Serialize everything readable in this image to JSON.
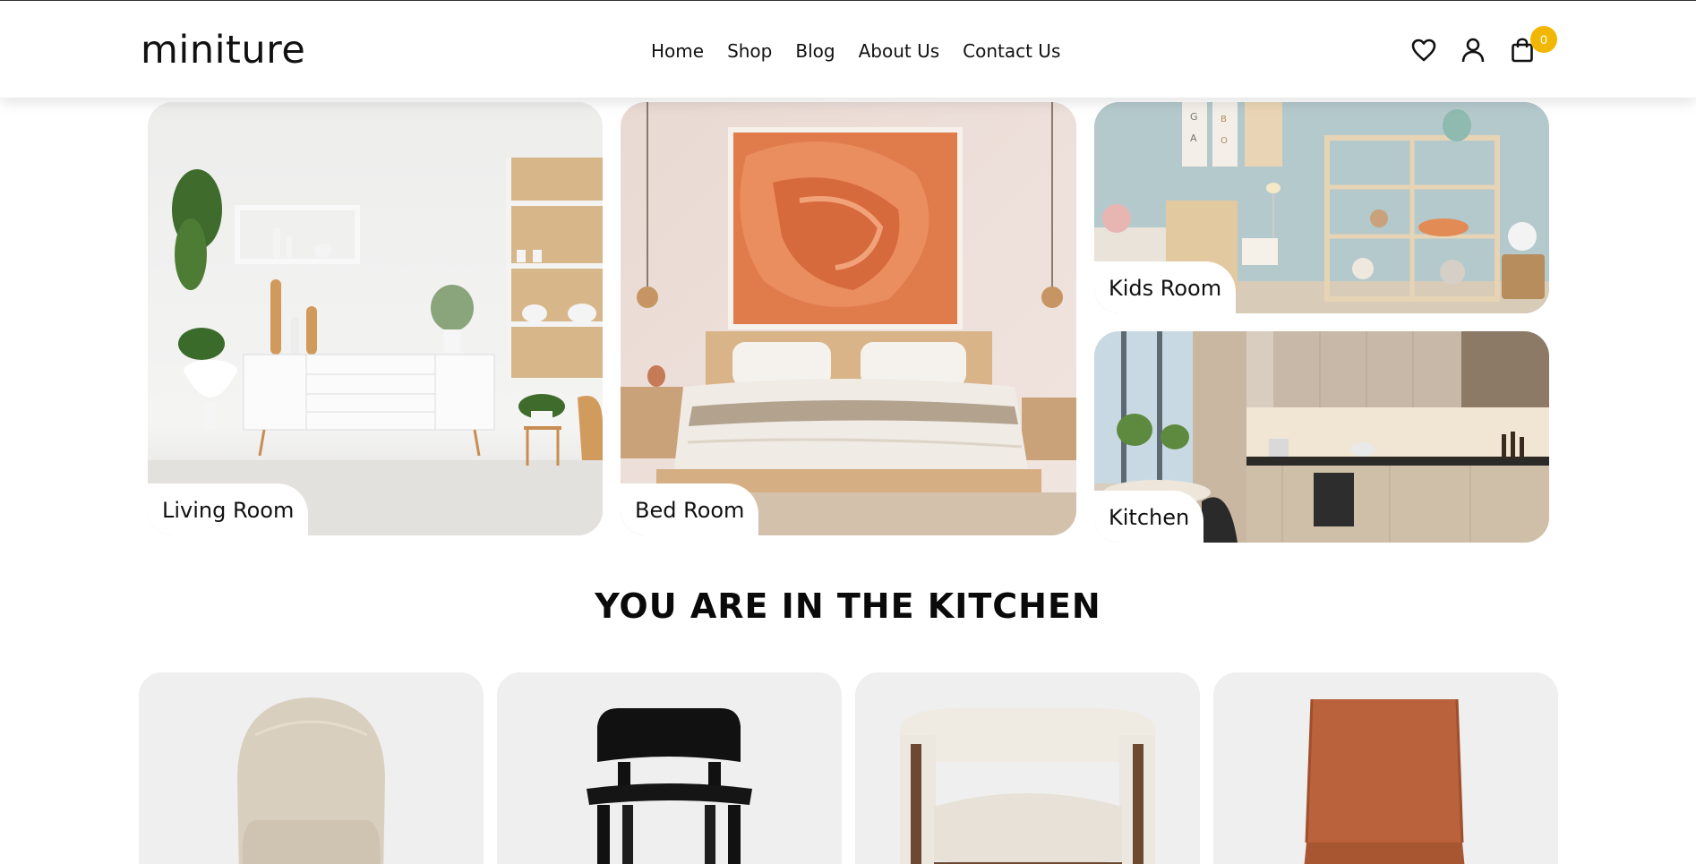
{
  "brand": {
    "logo": "miniture"
  },
  "nav": {
    "items": [
      "Home",
      "Shop",
      "Blog",
      "About Us",
      "Contact Us"
    ]
  },
  "header_icons": {
    "wishlist": "heart-icon",
    "account": "user-icon",
    "cart": "shopping-bag-icon",
    "cart_count": "0"
  },
  "categories": [
    {
      "label": "Living Room"
    },
    {
      "label": "Bed Room"
    },
    {
      "label": "Kids Room"
    },
    {
      "label": "Kitchen"
    }
  ],
  "section": {
    "title": "YOU ARE IN THE KITCHEN"
  },
  "colors": {
    "accent": "#f2b705",
    "text": "#111111",
    "card_bg": "#efefef"
  }
}
